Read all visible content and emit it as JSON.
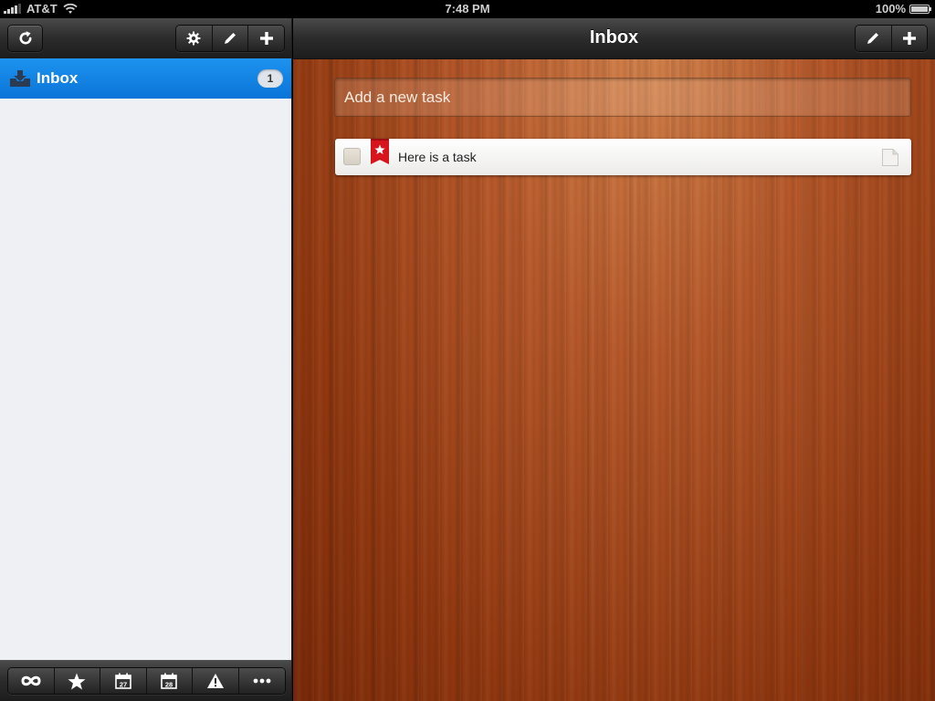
{
  "status_bar": {
    "carrier": "AT&T",
    "time": "7:48 PM",
    "battery": "100%"
  },
  "sidebar": {
    "buttons": {
      "refresh_icon": "refresh-icon",
      "settings_icon": "gear-icon",
      "edit_icon": "pencil-icon",
      "add_icon": "plus-icon"
    },
    "lists": [
      {
        "label": "Inbox",
        "count": "1",
        "selected": true,
        "icon": "inbox-icon"
      }
    ],
    "footer": [
      {
        "icon": "infinity-icon"
      },
      {
        "icon": "star-icon"
      },
      {
        "icon": "calendar-today-icon",
        "day": "27"
      },
      {
        "icon": "calendar-tomorrow-icon",
        "day": "28"
      },
      {
        "icon": "warning-icon"
      },
      {
        "icon": "more-icon"
      }
    ]
  },
  "main": {
    "title": "Inbox",
    "add_task_placeholder": "Add a new task",
    "tasks": [
      {
        "title": "Here is a task",
        "starred": true,
        "completed": false
      }
    ]
  },
  "colors": {
    "selection_blue": "#0a84e6",
    "wood": "#a0451a",
    "star_ribbon": "#d7141b"
  }
}
